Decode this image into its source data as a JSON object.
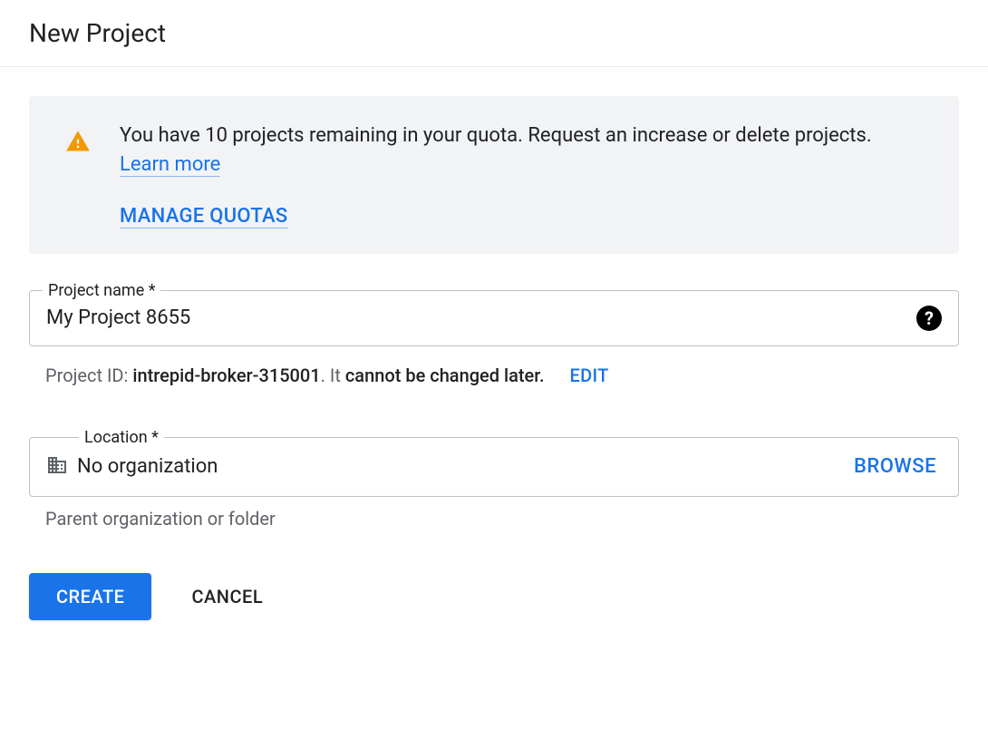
{
  "header": {
    "title": "New Project"
  },
  "quota": {
    "message": "You have 10 projects remaining in your quota. Request an increase or delete projects.",
    "learn_more": "Learn more",
    "manage_label": "MANAGE QUOTAS"
  },
  "project_name": {
    "label": "Project name *",
    "value": "My Project 8655"
  },
  "project_id": {
    "prefix": "Project ID: ",
    "id": "intrepid-broker-315001",
    "suffix_text1": ". It ",
    "suffix_bold": "cannot be changed later.",
    "edit_label": "EDIT"
  },
  "location": {
    "label": "Location *",
    "value": "No organization",
    "browse_label": "BROWSE",
    "helper": "Parent organization or folder"
  },
  "actions": {
    "create": "CREATE",
    "cancel": "CANCEL"
  }
}
